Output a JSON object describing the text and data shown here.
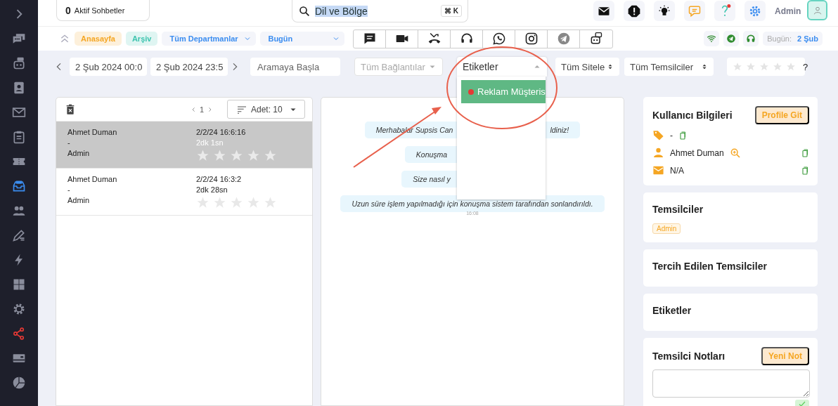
{
  "sidebar": {
    "items": [
      {
        "kind": "expand",
        "selected": false,
        "highlighted": false
      },
      {
        "kind": "chats",
        "selected": false,
        "highlighted": false
      },
      {
        "kind": "bot",
        "selected": false,
        "highlighted": false
      },
      {
        "kind": "contacts",
        "selected": false,
        "highlighted": false
      },
      {
        "kind": "mail",
        "selected": false,
        "highlighted": false
      },
      {
        "kind": "clipboard",
        "selected": false,
        "highlighted": false
      },
      {
        "kind": "ticket",
        "selected": false,
        "highlighted": false
      },
      {
        "kind": "inbox",
        "selected": true,
        "highlighted": false
      },
      {
        "kind": "people",
        "selected": false,
        "highlighted": false
      },
      {
        "kind": "edit",
        "selected": false,
        "highlighted": false
      },
      {
        "kind": "bolt",
        "selected": false,
        "highlighted": false
      },
      {
        "kind": "grid",
        "selected": false,
        "highlighted": false
      },
      {
        "kind": "gear",
        "selected": false,
        "highlighted": false
      },
      {
        "kind": "share",
        "selected": false,
        "highlighted": true
      },
      {
        "kind": "card",
        "selected": false,
        "highlighted": false
      },
      {
        "kind": "pie",
        "selected": false,
        "highlighted": false
      }
    ]
  },
  "top_bar": {
    "active_chats": {
      "count": "0",
      "label": "Aktif Sohbetler"
    },
    "search": {
      "value": "Dil ve Bölge",
      "shortcut": "⌘ K"
    },
    "user": "Admin"
  },
  "nav_bar": {
    "links": [
      {
        "label": "Anasayfa",
        "color": "#f5a623"
      },
      {
        "label": "Arşiv",
        "color": "#3cc4ae"
      }
    ],
    "selects": [
      "Tüm Departmanlar",
      "Bugün"
    ],
    "today": {
      "label": "Bugün:",
      "value": "2 Şub"
    }
  },
  "filters": {
    "start": "2 Şub 2024 00:0",
    "end": "2 Şub 2024 23:5",
    "search_placeholder": "Aramaya Başla",
    "connections_placeholder": "Tüm Bağlantılar",
    "tags": {
      "value": "Etiketler",
      "expanded": true,
      "options": [
        {
          "label": "Reklam Müşteris",
          "color": "#e53935",
          "selected": true
        }
      ]
    },
    "sites": "Tüm Sitele",
    "agents": "Tüm Temsilciler",
    "rating": {
      "stars": 0,
      "label": "?"
    }
  },
  "conversations": {
    "page": "1",
    "page_size": "Adet: 10",
    "items": [
      {
        "name": "Ahmet Duman",
        "detail": "-",
        "agent": "Admin",
        "time": "2/2/24 16:6:16",
        "duration": "2dk 1sn",
        "stars": 0,
        "selected": true
      },
      {
        "name": "Ahmet Duman",
        "detail": "-",
        "agent": "Admin",
        "time": "2/2/24 16:3:2",
        "duration": "2dk 28sn",
        "stars": 0,
        "selected": false
      }
    ]
  },
  "chat": {
    "messages": [
      {
        "parts": [
          "Merhabalar Supsis Can",
          "ldiniz!"
        ]
      },
      {
        "parts": [
          "Konuşma"
        ]
      },
      {
        "parts": [
          "Size nasıl y"
        ]
      },
      {
        "parts": [
          "Uzun süre işlem yapılmadığı için konuşma sistem tarafından sonlandırıldı."
        ],
        "time": "16:08"
      }
    ]
  },
  "user_info": {
    "title": "Kullanıcı Bilgileri",
    "action": "Profile Git",
    "fields": [
      {
        "kind": "tag",
        "value": "-"
      },
      {
        "kind": "person",
        "value": "Ahmet Duman"
      },
      {
        "kind": "email",
        "value": "N/A"
      }
    ]
  },
  "agents_card": {
    "title": "Temsilciler",
    "agents": [
      "Admin"
    ]
  },
  "preferred_card": {
    "title": "Tercih Edilen Temsilciler"
  },
  "tags_card": {
    "title": "Etiketler"
  },
  "notes_card": {
    "title": "Temsilci Notları",
    "action": "Yeni Not"
  }
}
